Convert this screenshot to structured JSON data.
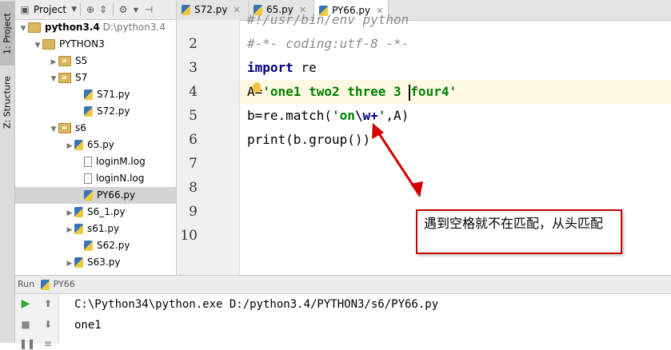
{
  "left_strip": {
    "project_tab": "1: Project",
    "structure_tab": "Z: Structure"
  },
  "project_pane": {
    "title": "Project",
    "tree": [
      {
        "label": "python3.4",
        "extra": "D:\\python3.4",
        "type": "root",
        "expanded": true
      },
      {
        "label": "PYTHON3",
        "type": "folder",
        "expanded": true
      },
      {
        "label": "S5",
        "type": "package",
        "expanded": false
      },
      {
        "label": "S7",
        "type": "package",
        "expanded": true
      },
      {
        "label": "S71.py",
        "type": "py"
      },
      {
        "label": "S72.py",
        "type": "py"
      },
      {
        "label": "s6",
        "type": "package",
        "expanded": true
      },
      {
        "label": "65.py",
        "type": "py",
        "expandable": true
      },
      {
        "label": "loginM.log",
        "type": "log"
      },
      {
        "label": "loginN.log",
        "type": "log"
      },
      {
        "label": "PY66.py",
        "type": "py",
        "selected": true
      },
      {
        "label": "S6_1.py",
        "type": "py",
        "expandable": true
      },
      {
        "label": "s61.py",
        "type": "py",
        "expandable": true
      },
      {
        "label": "S62.py",
        "type": "py"
      },
      {
        "label": "S63.py",
        "type": "py",
        "expandable": true
      }
    ]
  },
  "editor": {
    "tabs": [
      {
        "label": "S72.py",
        "active": false
      },
      {
        "label": "65.py",
        "active": false
      },
      {
        "label": "PY66.py",
        "active": true
      }
    ],
    "line_numbers": [
      "2",
      "3",
      "4",
      "5",
      "6",
      "7",
      "8",
      "9",
      "10"
    ],
    "line1_partial": "#!/usr/bin/env python",
    "line2": "#-*- coding:utf-8 -*-",
    "line3_kw": "import",
    "line3_rest": " re",
    "line4_a": "A=",
    "line4_str_a": "'one1 two2 three 3 ",
    "line4_str_b": "four4'",
    "line5_a": "b=re.match(",
    "line5_str_a": "'on",
    "line5_esc": "\\w+",
    "line5_str_b": "'",
    "line5_b": ",A)",
    "line6": "print(b.group())"
  },
  "annotation": {
    "text": "遇到空格就不在匹配，从头匹配",
    "border_color": "#c80000"
  },
  "run_panel": {
    "label": "Run",
    "config": "PY66",
    "console": [
      "C:\\Python34\\python.exe D:/python3.4/PYTHON3/s6/PY66.py",
      "one1"
    ]
  }
}
